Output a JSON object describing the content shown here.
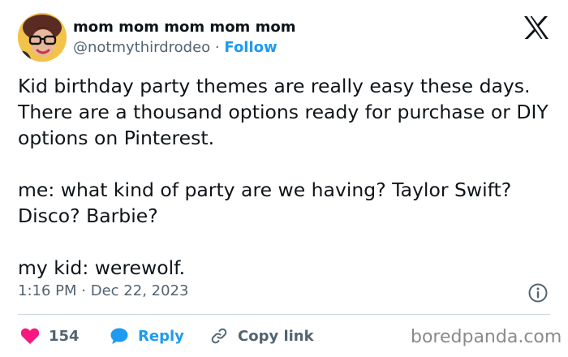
{
  "author": {
    "display_name": "mom mom mom mom mom",
    "handle": "@notmythirdrodeo",
    "separator": "·",
    "follow_label": "Follow"
  },
  "tweet": {
    "text": "Kid birthday party themes are really easy these days.  There are a thousand options ready for purchase or DIY options on Pinterest.\n\nme:  what kind of party are we having?  Taylor Swift? Disco?  Barbie?\n\nmy kid:  werewolf.",
    "time": "1:16 PM",
    "date_separator": "·",
    "date": "Dec 22, 2023"
  },
  "actions": {
    "like_count": "154",
    "reply_label": "Reply",
    "copy_link_label": "Copy link"
  },
  "watermark": "boredpanda.com",
  "icons": {
    "brand": "x-logo-icon",
    "info": "info-icon",
    "like": "heart-icon",
    "reply": "speech-bubble-icon",
    "copy": "link-icon"
  },
  "colors": {
    "link_blue": "#1d9bf0",
    "like_pink": "#f91880",
    "muted_text": "#536471",
    "primary_text": "#0f1419",
    "divider": "#cfd9de"
  }
}
